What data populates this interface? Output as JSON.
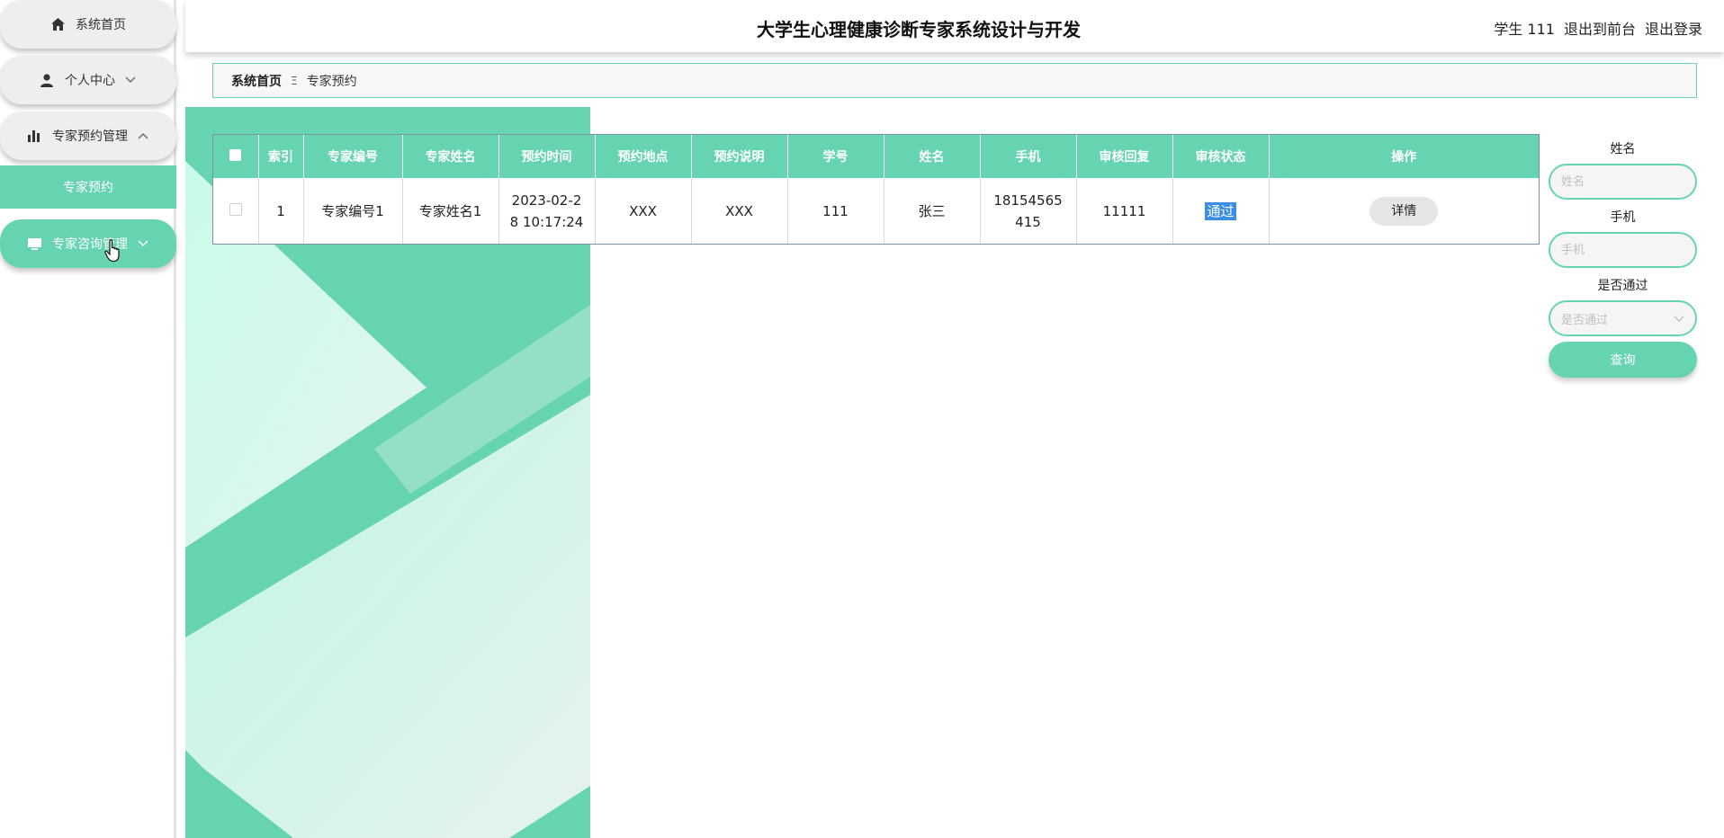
{
  "sidebar": {
    "items": [
      {
        "label": "系统首页",
        "icon": "home-icon"
      },
      {
        "label": "个人中心",
        "icon": "user-icon"
      },
      {
        "label": "专家预约管理",
        "icon": "bar-chart-icon"
      },
      {
        "label": "专家咨询管理",
        "icon": "monitor-icon"
      }
    ],
    "sub_item": "专家预约"
  },
  "header": {
    "title": "大学生心理健康诊断专家系统设计与开发",
    "user": "学生 111",
    "to_front": "退出到前台",
    "logout": "退出登录"
  },
  "breadcrumb": {
    "home": "系统首页",
    "separator": "Ξ",
    "current": "专家预约"
  },
  "table": {
    "columns": [
      "",
      "索引",
      "专家编号",
      "专家姓名",
      "预约时间",
      "预约地点",
      "预约说明",
      "学号",
      "姓名",
      "手机",
      "审核回复",
      "审核状态",
      "操作"
    ],
    "rows": [
      {
        "index": "1",
        "expert_no": "专家编号1",
        "expert_name": "专家姓名1",
        "time": "2023-02-28 10:17:24",
        "place": "XXX",
        "desc": "XXX",
        "student_no": "111",
        "name": "张三",
        "phone": "18154565415",
        "reply": "11111",
        "status": "通过",
        "action": "详情"
      }
    ]
  },
  "search": {
    "name_label": "姓名",
    "name_placeholder": "姓名",
    "phone_label": "手机",
    "phone_placeholder": "手机",
    "pass_label": "是否通过",
    "pass_placeholder": "是否通过",
    "button": "查询"
  },
  "colors": {
    "accent": "#66d4b0",
    "selection": "#3a8ee6"
  }
}
